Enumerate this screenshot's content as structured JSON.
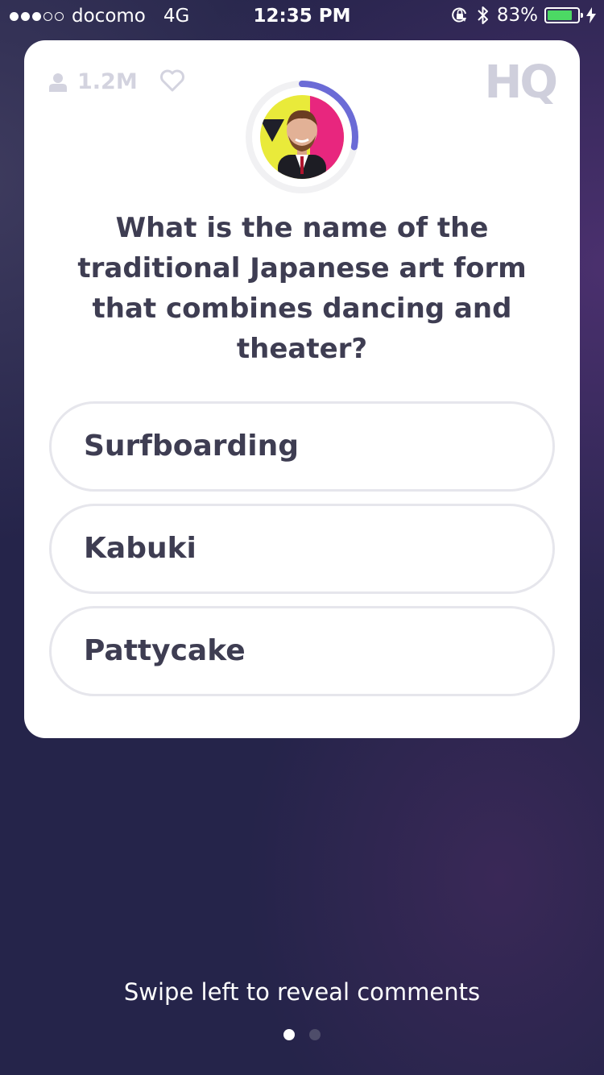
{
  "status_bar": {
    "signal_full": 3,
    "signal_empty": 2,
    "carrier": "docomo",
    "network": "4G",
    "time": "12:35 PM",
    "battery_percent": "83%",
    "battery_level": 0.83,
    "battery_color": "#4cd964",
    "icons": [
      "orientation-lock-icon",
      "bluetooth-icon",
      "battery-icon",
      "charging-bolt-icon"
    ]
  },
  "game": {
    "viewer_count": "1.2M",
    "logo_text": "HQ",
    "question": "What is the name of the traditional Japanese art form that combines dancing and theater?",
    "answers": [
      {
        "label": "Surfboarding"
      },
      {
        "label": "Kabuki"
      },
      {
        "label": "Pattycake"
      }
    ],
    "timer_remaining_fraction": 0.28,
    "timer_color": "#6b6bd6"
  },
  "footer": {
    "hint": "Swipe left to reveal comments",
    "page_count": 2,
    "active_page": 1
  },
  "colors": {
    "background": "#25244a",
    "card": "#ffffff",
    "text": "#3e3d52",
    "muted": "#d3d3df"
  }
}
